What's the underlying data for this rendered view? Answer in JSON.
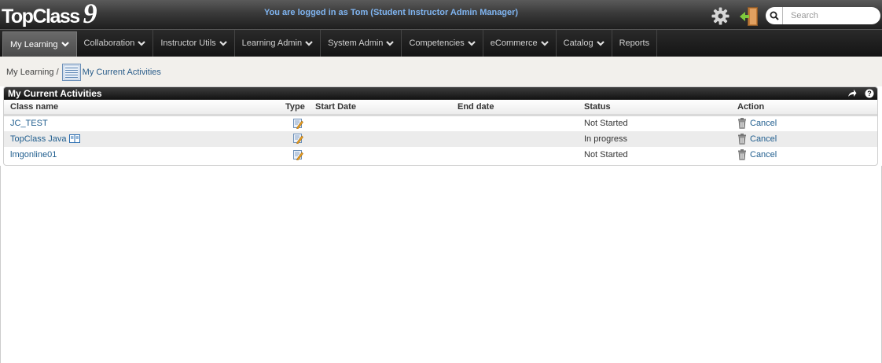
{
  "header": {
    "logo_text": "TopClass",
    "logo_version": "9",
    "login_message": "You are logged in as Tom (Student Instructor Admin Manager)",
    "settings_icon": "gear-icon",
    "logout_icon": "exit-door-icon",
    "search": {
      "placeholder": "Search",
      "value": "",
      "icon": "search-icon"
    }
  },
  "nav": {
    "items": [
      {
        "label": "My Learning",
        "dropdown": true,
        "active": true
      },
      {
        "label": "Collaboration",
        "dropdown": true
      },
      {
        "label": "Instructor Utils",
        "dropdown": true
      },
      {
        "label": "Learning Admin",
        "dropdown": true
      },
      {
        "label": "System Admin",
        "dropdown": true
      },
      {
        "label": "Competencies",
        "dropdown": true
      },
      {
        "label": "eCommerce",
        "dropdown": true
      },
      {
        "label": "Catalog",
        "dropdown": true
      },
      {
        "label": "Reports",
        "dropdown": false
      }
    ]
  },
  "breadcrumb": {
    "parent": "My Learning /",
    "current": "My Current Activities",
    "icon": "activity-list-icon"
  },
  "panel": {
    "title": "My Current Activities",
    "share_icon": "share-arrow-icon",
    "help_icon": "help-icon",
    "columns": [
      "Class name",
      "Type",
      "Start Date",
      "End date",
      "Status",
      "Action"
    ],
    "rows": [
      {
        "class_name": "JC_TEST",
        "type_icon": "edit-pencil-icon",
        "start_date": "",
        "end_date": "",
        "status": "Not Started",
        "action": "Cancel",
        "book_icon": false
      },
      {
        "class_name": "TopClass Java",
        "type_icon": "edit-pencil-icon",
        "start_date": "",
        "end_date": "",
        "status": "In progress",
        "action": "Cancel",
        "book_icon": true
      },
      {
        "class_name": "lmgonline01",
        "type_icon": "edit-pencil-icon",
        "start_date": "",
        "end_date": "",
        "status": "Not Started",
        "action": "Cancel",
        "book_icon": false
      }
    ]
  },
  "colors": {
    "header_text": "#7fb4f0",
    "link": "#1f5d8e",
    "nav_bg": "#1e1e1e",
    "alt_row": "#ececec"
  }
}
